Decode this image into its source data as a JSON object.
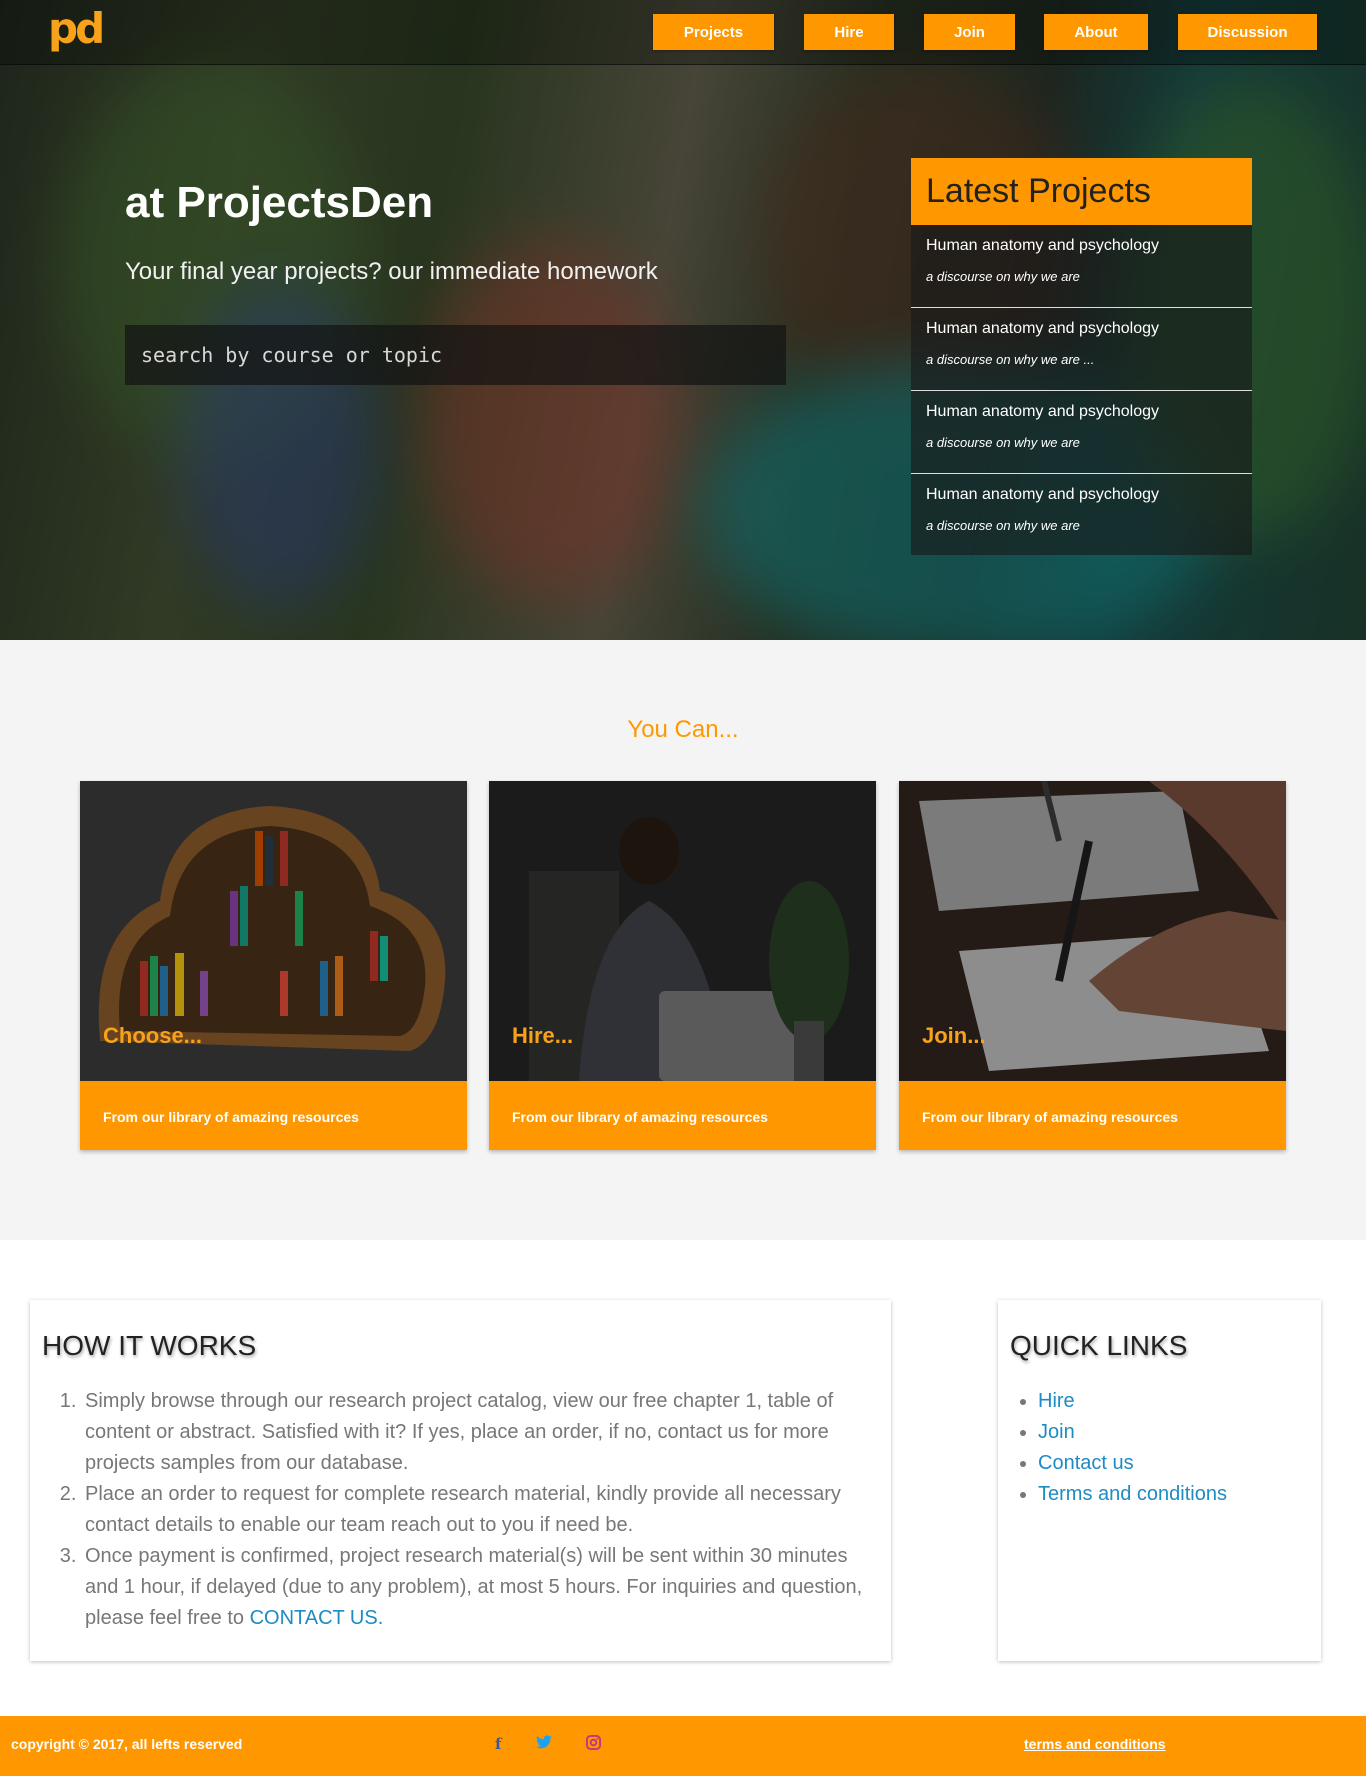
{
  "brand": {
    "logo_text": "pd",
    "accent": "#ff9800"
  },
  "nav": {
    "items": [
      "Projects",
      "Hire",
      "Join",
      "About",
      "Discussion"
    ]
  },
  "hero": {
    "title": "at ProjectsDen",
    "subtitle": "Your final year projects? our immediate homework",
    "search_placeholder": "search by course or topic"
  },
  "latest": {
    "heading": "Latest Projects",
    "items": [
      {
        "title": "Human anatomy and psychology",
        "desc": "a discourse on why we are"
      },
      {
        "title": "Human anatomy and psychology",
        "desc": "a discourse on why we are ..."
      },
      {
        "title": "Human anatomy and psychology",
        "desc": "a discourse on why we are"
      },
      {
        "title": "Human anatomy and psychology",
        "desc": "a discourse on why we are"
      }
    ]
  },
  "you_can": {
    "heading": "You Can...",
    "cards": [
      {
        "label": "Choose...",
        "footer": "From our library of amazing resources",
        "image": "bookshelf-image"
      },
      {
        "label": "Hire...",
        "footer": "From our library of amazing resources",
        "image": "man-at-laptop-image"
      },
      {
        "label": "Join...",
        "footer": "From our library of amazing resources",
        "image": "writing-notes-image"
      }
    ]
  },
  "how_it_works": {
    "heading": "HOW IT WORKS",
    "steps": [
      "Simply browse through our research project catalog, view our free chapter 1, table of content or abstract. Satisfied with it? If yes, place an order, if no, contact us for more projects samples from our database.",
      "Place an order to request for complete research material, kindly provide all necessary contact details to enable our team reach out to you if need be.",
      "Once payment is confirmed, project research material(s) will be sent within 30 minutes and 1 hour, if delayed (due to any problem), at most 5 hours. For inquiries and question, please feel free to "
    ],
    "contact_link": "CONTACT US."
  },
  "quick_links": {
    "heading": "QUICK LINKS",
    "items": [
      "Hire",
      "Join",
      "Contact us",
      "Terms and conditions"
    ]
  },
  "footer": {
    "copyright": "copyright © 2017, all lefts reserved",
    "social": [
      {
        "icon": "facebook-icon",
        "glyph": "f",
        "color": "#3b5998"
      },
      {
        "icon": "twitter-icon",
        "glyph": "🐦",
        "color": "#1da1f2"
      },
      {
        "icon": "instagram-icon",
        "glyph": "◎",
        "color": "#c13584"
      }
    ],
    "terms": "terms and conditions"
  }
}
